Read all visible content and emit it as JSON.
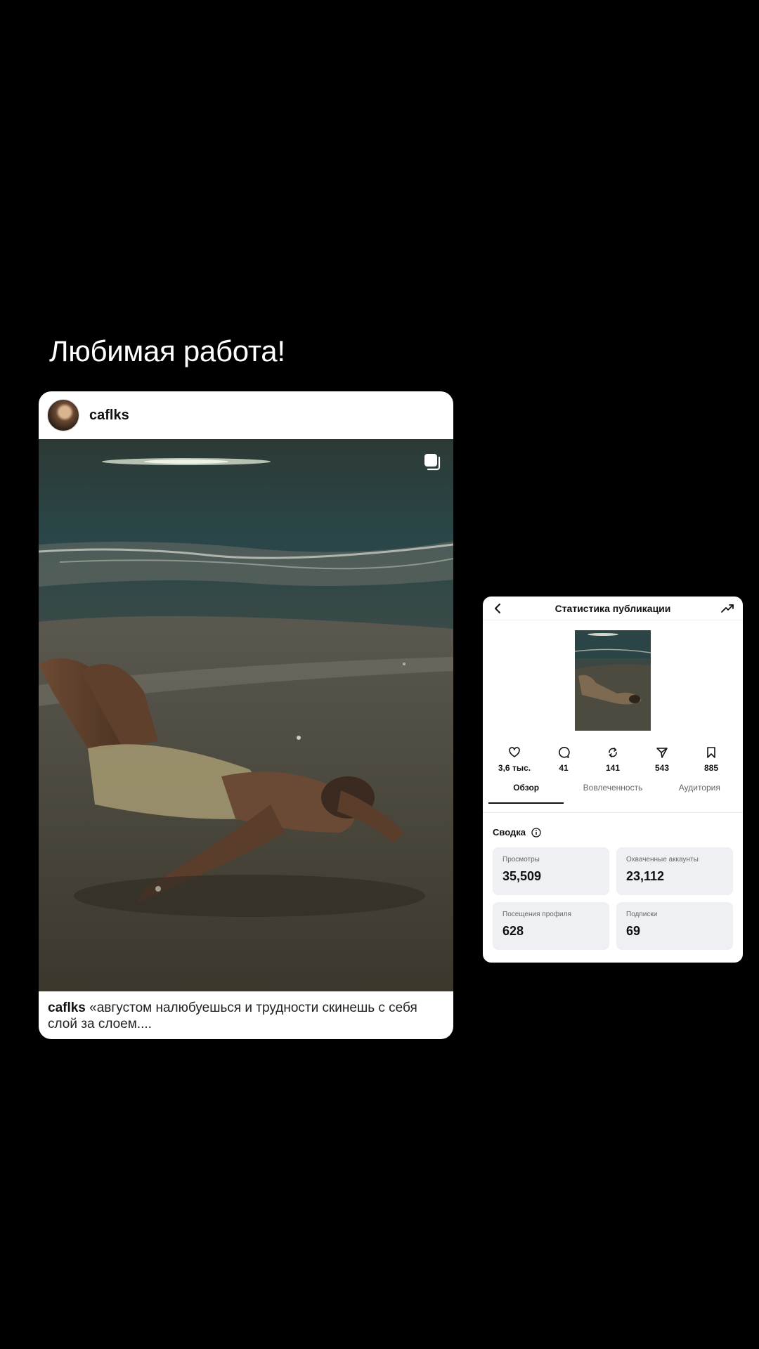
{
  "headline": "Любимая работа!",
  "post": {
    "username": "caflks",
    "caption_user": "caflks",
    "caption_text": " «августом налюбуешься и трудности скинешь с себя слой за слоем....",
    "multi_image_icon": "carousel-icon"
  },
  "insights": {
    "title": "Статистика публикации",
    "back_icon": "chevron-left-icon",
    "trend_icon": "trending-up-icon",
    "metrics": [
      {
        "icon": "heart-icon",
        "value": "3,6 тыс."
      },
      {
        "icon": "comment-icon",
        "value": "41"
      },
      {
        "icon": "repost-icon",
        "value": "141"
      },
      {
        "icon": "share-icon",
        "value": "543"
      },
      {
        "icon": "bookmark-icon",
        "value": "885"
      }
    ],
    "tabs": [
      {
        "label": "Обзор",
        "active": true
      },
      {
        "label": "Вовлеченность",
        "active": false
      },
      {
        "label": "Аудитория",
        "active": false
      }
    ],
    "summary_title": "Сводка",
    "stats": [
      {
        "label": "Просмотры",
        "value": "35,509"
      },
      {
        "label": "Охваченные аккаунты",
        "value": "23,112"
      },
      {
        "label": "Посещения профиля",
        "value": "628"
      },
      {
        "label": "Подписки",
        "value": "69"
      }
    ]
  }
}
